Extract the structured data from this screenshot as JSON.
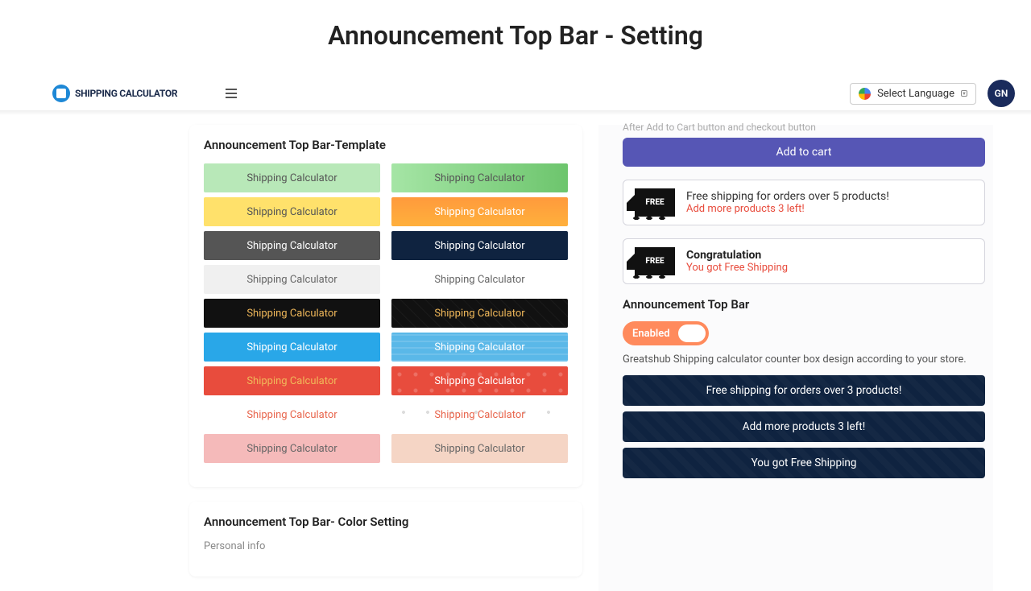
{
  "title": "Announcement Top Bar - Setting",
  "brand": "Shipping Calculator",
  "lang": "Select Language",
  "avatar": "GN",
  "left": {
    "tpl_title": "Announcement Top Bar-Template",
    "tpl_label": "Shipping Calculator",
    "color_title": "Announcement Top Bar- Color Setting",
    "color_sub": "Personal info"
  },
  "right": {
    "hint": "After Add to Cart button and checkout button",
    "cart": "Add to cart",
    "box1_l1": "Free shipping for orders over 5 products!",
    "box1_l2": "Add more products 3 left!",
    "box2_l1": "Congratulation",
    "box2_l2": "You got Free Shipping",
    "truck": "FREE",
    "section": "Announcement Top Bar",
    "toggle": "Enabled",
    "desc": "Greatshub Shipping calculator counter box design according to your store.",
    "bar1": "Free shipping for orders over 3 products!",
    "bar2": "Add more products 3 left!",
    "bar3": "You got Free Shipping"
  }
}
